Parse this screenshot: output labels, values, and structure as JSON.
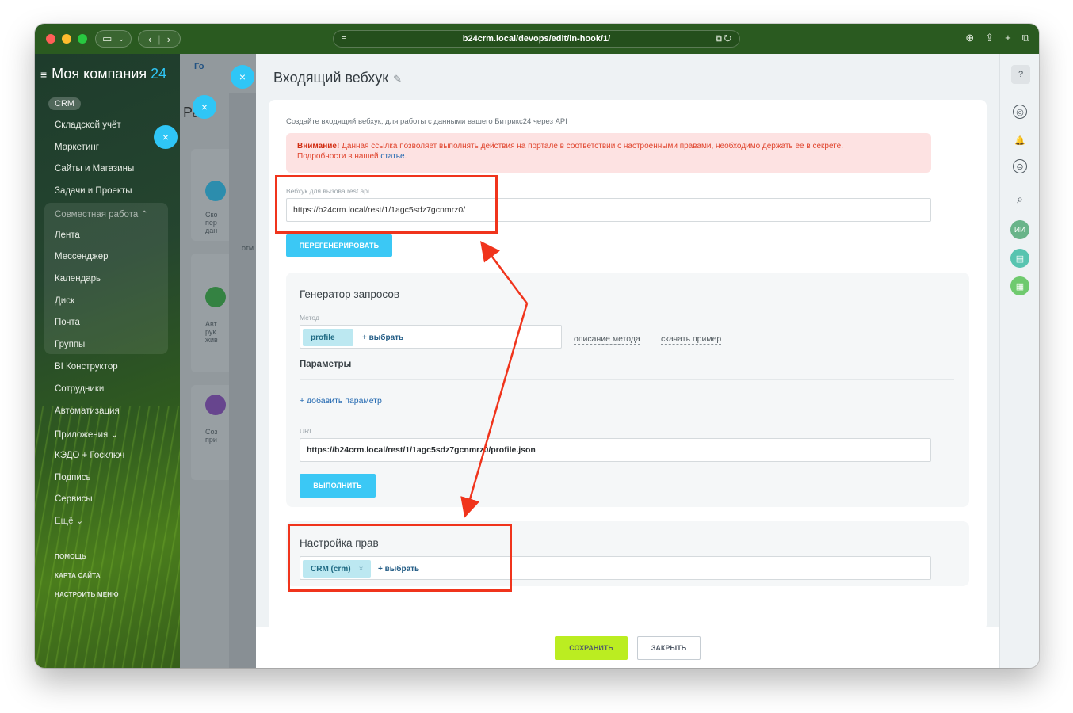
{
  "browser": {
    "url": "b24crm.local/devops/edit/in-hook/1/"
  },
  "sidebar": {
    "company": "Моя компания",
    "company_suffix": "24",
    "crm_pill": "CRM",
    "items": [
      {
        "label": "Складской учёт"
      },
      {
        "label": "Маркетинг"
      },
      {
        "label": "Сайты и Магазины"
      },
      {
        "label": "Задачи и Проекты"
      },
      {
        "label": "Совместная работа ⌃"
      },
      {
        "label": "Лента"
      },
      {
        "label": "Мессенджер"
      },
      {
        "label": "Календарь"
      },
      {
        "label": "Диск"
      },
      {
        "label": "Почта"
      },
      {
        "label": "Группы"
      },
      {
        "label": "BI Конструктор"
      },
      {
        "label": "Сотрудники"
      },
      {
        "label": "Автоматизация"
      },
      {
        "label": "Приложения ⌄"
      },
      {
        "label": "КЭДО + Госключ"
      },
      {
        "label": "Подпись"
      },
      {
        "label": "Сервисы"
      },
      {
        "label": "Ещё ⌄"
      }
    ],
    "footer_links": [
      "ПОМОЩЬ",
      "КАРТА САЙТА",
      "НАСТРОИТЬ МЕНЮ"
    ]
  },
  "background": {
    "tab": "Го",
    "heading": "Ра",
    "card_texts": [
      "Ско пер дан",
      "Авт рук жив",
      "Соз при"
    ],
    "side_text": "отм"
  },
  "panel": {
    "title": "Входящий вебхук",
    "hint": "Создайте входящий вебхук, для работы с данными вашего Битрикс24 через API",
    "alert_bold": "Внимание!",
    "alert_text": " Данная ссылка позволяет выполнять действия на портале в соответствии с настроенными правами, необходимо держать её в секрете.",
    "alert_line2": "Подробности в нашей ",
    "alert_link": "статье",
    "alert_end": ".",
    "webhook_label": "Вебхук для вызова rest api",
    "webhook_value": "https://b24crm.local/rest/1/1agc5sdz7gcnmrz0/",
    "regenerate_button": "ПЕРЕГЕНЕРИРОВАТЬ",
    "generator": {
      "title": "Генератор запросов",
      "method_label": "Метод",
      "method_chip": "profile",
      "method_select": "+ выбрать",
      "method_desc_link": "описание метода",
      "download_link": "скачать пример",
      "params_title": "Параметры",
      "add_param": "+ добавить параметр",
      "url_label": "URL",
      "url_value": "https://b24crm.local/rest/1/1agc5sdz7gcnmrz0/profile.json",
      "run_button": "ВЫПОЛНИТЬ"
    },
    "rights": {
      "title": "Настройка прав",
      "chip": "CRM (crm)",
      "chip_remove": "×",
      "select": "+ выбрать"
    },
    "save_button": "СОХРАНИТЬ",
    "close_button": "ЗАКРЫТЬ"
  },
  "rail": {
    "avatar_initials": "ИИ"
  },
  "colors": {
    "accent": "#2fc6f6",
    "save": "#bbed21",
    "annotation": "#f0341c",
    "toolbar": "#2a5a20"
  }
}
